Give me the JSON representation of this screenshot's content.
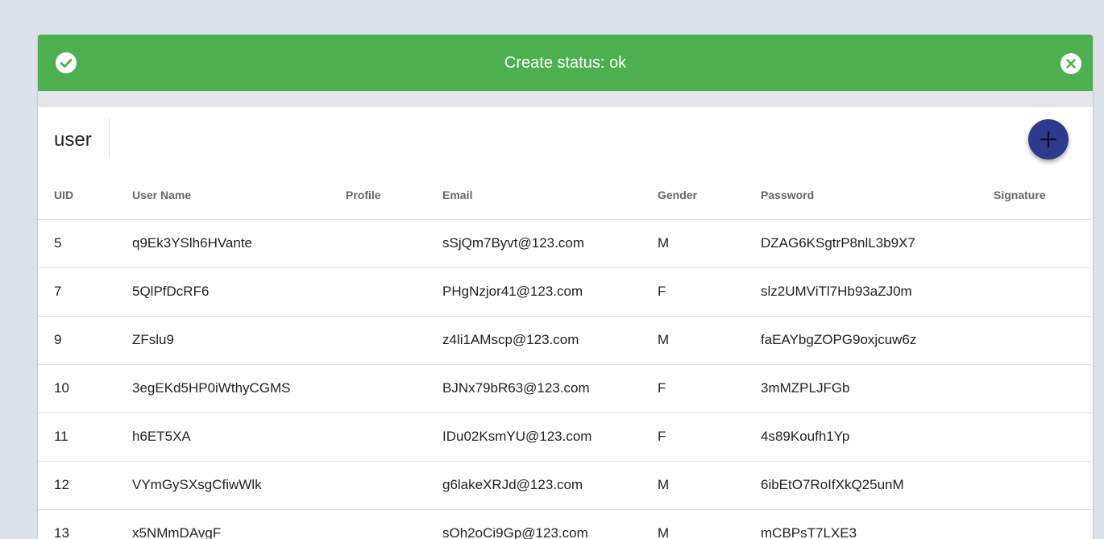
{
  "alert": {
    "text": "Create status: ok",
    "color": "#4caf50"
  },
  "toolbar": {
    "title": "user",
    "add_icon": "plus-icon",
    "fab_color": "#2e3a8c"
  },
  "table": {
    "headers": [
      "UID",
      "User Name",
      "Profile",
      "Email",
      "Gender",
      "Password",
      "Signature"
    ],
    "rows": [
      [
        "5",
        "q9Ek3YSlh6HVante",
        "",
        "sSjQm7Byvt@123.com",
        "M",
        "DZAG6KSgtrP8nlL3b9X7",
        ""
      ],
      [
        "7",
        "5QlPfDcRF6",
        "",
        "PHgNzjor41@123.com",
        "F",
        "slz2UMViTl7Hb93aZJ0m",
        ""
      ],
      [
        "9",
        "ZFslu9",
        "",
        "z4li1AMscp@123.com",
        "M",
        "faEAYbgZOPG9oxjcuw6z",
        ""
      ],
      [
        "10",
        "3egEKd5HP0iWthyCGMS",
        "",
        "BJNx79bR63@123.com",
        "F",
        "3mMZPLJFGb",
        ""
      ],
      [
        "11",
        "h6ET5XA",
        "",
        "IDu02KsmYU@123.com",
        "F",
        "4s89Koufh1Yp",
        ""
      ],
      [
        "12",
        "VYmGySXsgCfiwWlk",
        "",
        "g6lakeXRJd@123.com",
        "M",
        "6ibEtO7RoIfXkQ25unM",
        ""
      ],
      [
        "13",
        "x5NMmDAvgF",
        "",
        "sOh2oCi9Gp@123.com",
        "M",
        "mCBPsT7LXE3",
        ""
      ]
    ]
  }
}
